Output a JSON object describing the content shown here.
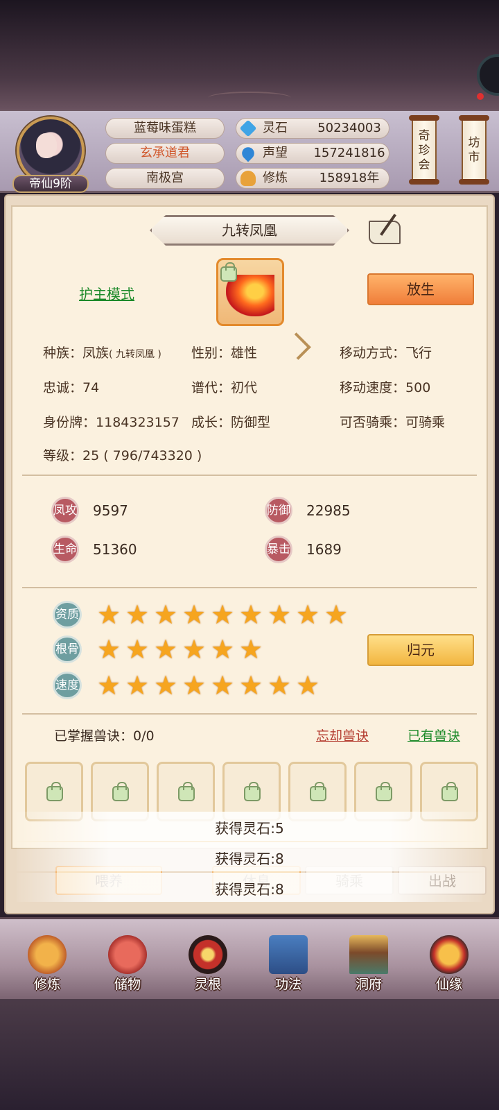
{
  "player": {
    "rank": "帝仙9阶",
    "name": "蓝莓味蛋糕",
    "title": "玄承道君",
    "sect": "南极宫"
  },
  "resources": [
    {
      "label": "灵石",
      "value": "50234003",
      "icon": "spirit-stone-icon"
    },
    {
      "label": "声望",
      "value": "157241816",
      "icon": "prestige-icon"
    },
    {
      "label": "修炼",
      "value": "158918年",
      "icon": "cultivation-icon"
    }
  ],
  "side_menu": {
    "treasure": "奇珍会",
    "market": "坊市"
  },
  "pet": {
    "name": "九转凤凰",
    "mode_link": "护主模式",
    "release_button": "放生",
    "info": {
      "race_label": "种族：",
      "race_value": "凤族",
      "race_note": "( 九转凤凰 )",
      "gender_label": "性别：",
      "gender_value": "雄性",
      "move_label": "移动方式：",
      "move_value": "飞行",
      "loyalty_label": "忠诚：",
      "loyalty_value": "74",
      "lineage_label": "谱代：",
      "lineage_value": "初代",
      "speed_label": "移动速度：",
      "speed_value": "500",
      "id_label": "身份牌：",
      "id_value": "1184323157",
      "growth_label": "成长：",
      "growth_value": "防御型",
      "ride_label": "可否骑乘：",
      "ride_value": "可骑乘",
      "level_label": "等级：",
      "level_value": "25 ( 796/743320 )"
    },
    "stats": [
      {
        "badge": "凤攻",
        "value": "9597"
      },
      {
        "badge": "防御",
        "value": "22985"
      },
      {
        "badge": "生命",
        "value": "51360"
      },
      {
        "badge": "暴击",
        "value": "1689"
      }
    ],
    "aptitudes": [
      {
        "badge": "资质",
        "stars": 9
      },
      {
        "badge": "根骨",
        "stars": 6
      },
      {
        "badge": "速度",
        "stars": 8
      }
    ],
    "restore_button": "归元",
    "skills": {
      "label": "已掌握兽诀：0/0",
      "forget_link": "忘却兽诀",
      "owned_link": "已有兽诀",
      "slot_count": 7
    }
  },
  "toasts": [
    "获得灵石:5",
    "获得灵石:8",
    "获得灵石:8"
  ],
  "actions": [
    "喂养",
    "休息",
    "骑乘",
    "出战"
  ],
  "nav": [
    "修炼",
    "储物",
    "灵根",
    "功法",
    "洞府",
    "仙缘"
  ],
  "colors": {
    "accent_orange": "#f07e3a",
    "link_green": "#1d8a2a",
    "link_red": "#b33a2e",
    "star": "#f6a51f"
  }
}
